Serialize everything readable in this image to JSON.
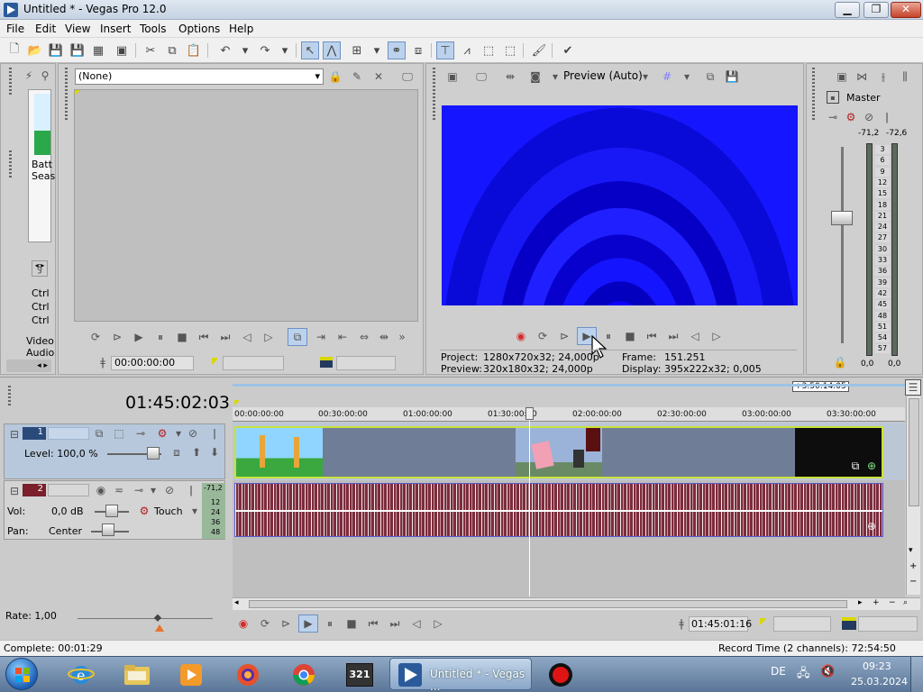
{
  "window": {
    "title": "Untitled * - Vegas Pro 12.0",
    "min": "▁",
    "max": "❐",
    "close": "✕"
  },
  "menu": [
    "File",
    "Edit",
    "View",
    "Insert",
    "Tools",
    "Options",
    "Help"
  ],
  "explorer": {
    "thumb_label_1": "Batt",
    "thumb_label_2": "Seas",
    "ctrl_1": "Ctrl",
    "ctrl_2": "Ctrl",
    "ctrl_3": "Ctrl",
    "tab_video": "Video",
    "tab_audio": "Audio"
  },
  "trimmer": {
    "source": "(None)",
    "time": "00:00:00:00"
  },
  "preview": {
    "mode": "Preview (Auto)",
    "project_label": "Project:",
    "project_value": "1280x720x32; 24,000p",
    "preview_label": "Preview:",
    "preview_value": "320x180x32; 24,000p",
    "frame_label": "Frame:",
    "frame_value": "151.251",
    "display_label": "Display:",
    "display_value": "395x222x32; 0,005"
  },
  "mixer": {
    "label": "Master",
    "peak_left": "-71,2",
    "peak_right": "-72,6",
    "scale": [
      "3",
      "6",
      "9",
      "12",
      "15",
      "18",
      "21",
      "24",
      "27",
      "30",
      "33",
      "36",
      "39",
      "42",
      "45",
      "48",
      "51",
      "54",
      "57"
    ],
    "bottom_left": "0,0",
    "bottom_right": "0,0"
  },
  "timeline": {
    "timecode": "01:45:02:03",
    "end_marker": "+3:50:14:05",
    "ruler": [
      "00:00:00:00",
      "00:30:00:00",
      "01:00:00:00",
      "01:30:00:00",
      "02:00:00:00",
      "02:30:00:00",
      "03:00:00:00",
      "03:30:00:00"
    ],
    "video_track": {
      "number": "1",
      "level": "Level: 100,0 %"
    },
    "audio_track": {
      "number": "2",
      "vol_label": "Vol:",
      "vol_value": "0,0 dB",
      "pan_label": "Pan:",
      "pan_value": "Center",
      "mode": "Touch",
      "meter_top": "-71,2",
      "meter_scale": [
        "12",
        "24",
        "36",
        "48"
      ]
    },
    "rate": "Rate: 1,00",
    "cursor_time": "01:45:01:16"
  },
  "status": {
    "complete": "Complete: 00:01:29",
    "record_time": "Record Time (2 channels): 72:54:50"
  },
  "taskbar": {
    "active_label": "Untitled * - Vegas ...",
    "lang": "DE",
    "time": "09:23",
    "date": "25.03.2024",
    "app_321": "321"
  }
}
